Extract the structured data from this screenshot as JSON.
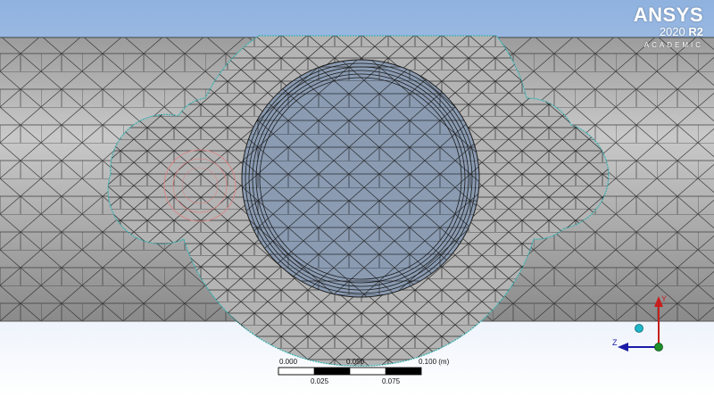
{
  "branding": {
    "product": "ANSYS",
    "version": "2020",
    "release": "R2",
    "edition": "ACADEMIC"
  },
  "scale_bar": {
    "top_labels": [
      "0.000",
      "0.050",
      "0.100 (m)"
    ],
    "bottom_labels": [
      "0.025",
      "0.075"
    ]
  },
  "triad": {
    "axis_z": "Z",
    "axis_y": "Y",
    "colors": {
      "z": "#1a1aa8",
      "y": "#c81e1e",
      "origin": "#1f8f2a",
      "iso_ball": "#1fb7c8"
    }
  },
  "colors": {
    "background_top": "#8fb2df",
    "background_bottom": "#ffffff",
    "mesh_surface": "#a9a9a9",
    "mesh_lines": "#1a1a1a",
    "inner_face": "#8a9bb2",
    "edge_highlight": "#3fb2b2",
    "selection_outline": "#d88888"
  }
}
